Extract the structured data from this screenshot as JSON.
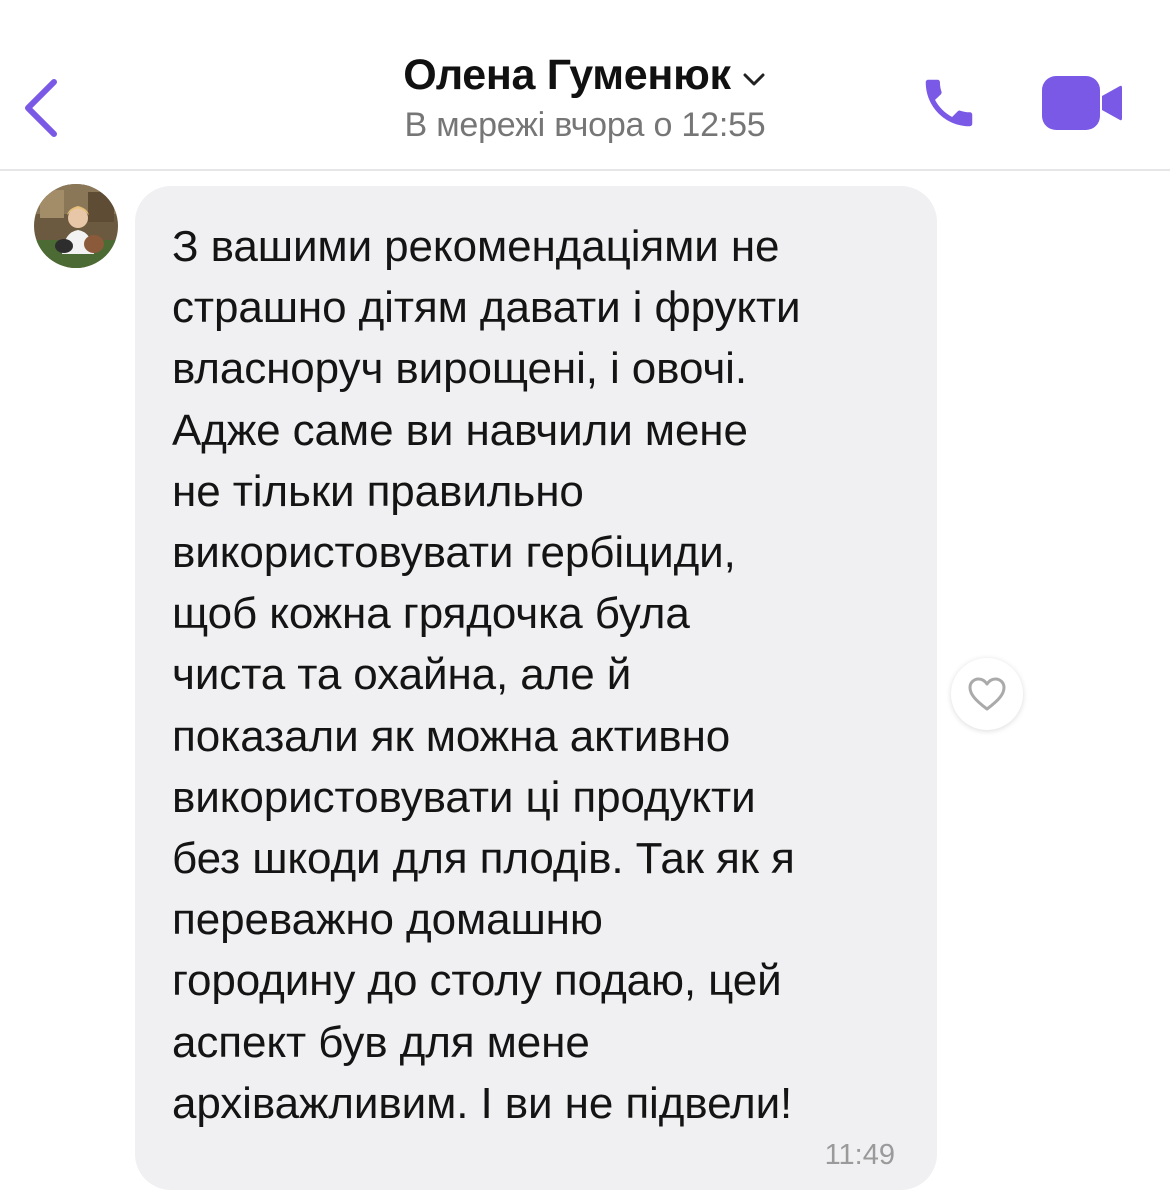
{
  "header": {
    "back_icon": "chevron-left-icon",
    "contact_name": "Олена Гуменюк",
    "status": "В мережі вчора о 12:55",
    "call_icon": "phone-icon",
    "video_icon": "video-camera-icon"
  },
  "colors": {
    "accent": "#7a59e6",
    "bubble": "#f0f0f2",
    "status_text": "#767676",
    "time_text": "#9a9a9a"
  },
  "message": {
    "text": "З вашими рекомендаціями не\nстрашно дітям давати і фрукти\nвласноруч вирощені, і овочі.\nАдже саме ви навчили мене\nне тільки правильно\nвикористовувати гербіциди,\nщоб кожна грядочка була\nчиста та охайна, але й\nпоказали як можна активно\nвикористовувати ці продукти\nбез шкоди для плодів. Так як я\nпереважно домашню\nгородину до столу подаю, цей\nаспект був для мене\nархіважливим. І ви не підвели!",
    "time": "11:49",
    "like_icon": "heart-outline-icon"
  }
}
